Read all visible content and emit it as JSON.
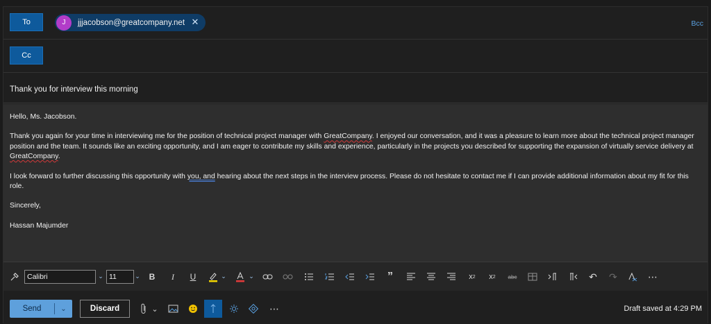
{
  "to": {
    "button_label": "To",
    "recipient": {
      "initial": "J",
      "email": "jjjacobson@greatcompany.net",
      "avatar_color": "#b23cc9"
    },
    "bcc_label": "Bcc"
  },
  "cc": {
    "button_label": "Cc"
  },
  "subject": "Thank you for interview this morning",
  "body": {
    "greeting": "Hello, Ms. Jacobson.",
    "p1_a": "Thank you again for your time in interviewing me for the position of technical project manager with ",
    "p1_company": "GreatCompany",
    "p1_b": ". I enjoyed our conversation, and it was a pleasure to learn more about the technical project manager position and the team. It sounds like an exciting opportunity, and I am eager to contribute my skills and experience, particularly in the projects you described for supporting the expansion of virtually service delivery at ",
    "p1_company2": "GreatCompany",
    "p1_c": ".",
    "p2_a": "I look forward to further discussing this opportunity with ",
    "p2_flag": "you, and",
    "p2_b": " hearing about the next steps in the interview process. Please do not hesitate to contact me if I can provide additional information about my fit for this role.",
    "closing": "Sincerely,",
    "signature": "Hassan Majumder"
  },
  "toolbar": {
    "font_family": "Calibri",
    "font_size": "11"
  },
  "bottom": {
    "send_label": "Send",
    "discard_label": "Discard",
    "status": "Draft saved at 4:29 PM"
  },
  "colors": {
    "accent": "#0e5a9c",
    "send": "#5ea0dc",
    "link": "#5aa0e0",
    "spell_error": "#d23a3a"
  }
}
